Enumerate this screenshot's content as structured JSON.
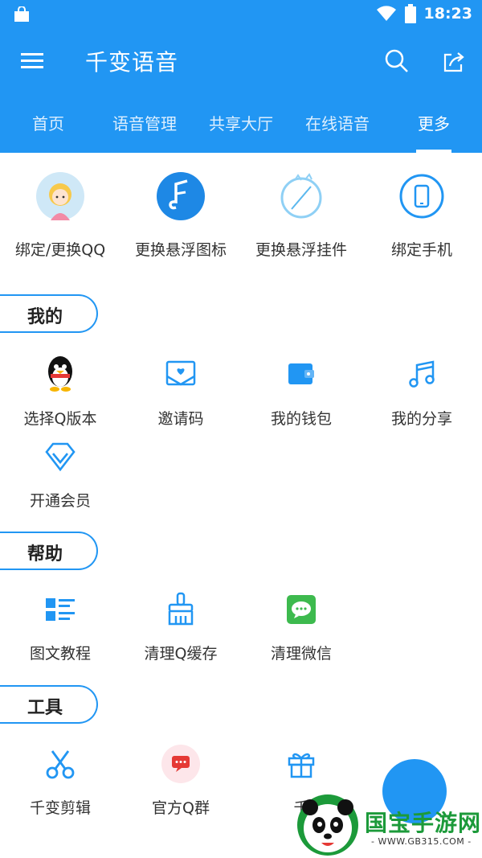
{
  "status_bar": {
    "time": "18:23"
  },
  "app": {
    "title": "千变语音"
  },
  "tabs": [
    {
      "label": "首页"
    },
    {
      "label": "语音管理"
    },
    {
      "label": "共享大厅"
    },
    {
      "label": "在线语音"
    },
    {
      "label": "更多"
    }
  ],
  "active_tab": "更多",
  "top_actions": [
    {
      "label": "绑定/更换QQ",
      "icon": "girl-avatar-icon"
    },
    {
      "label": "更换悬浮图标",
      "icon": "music-note-logo-icon"
    },
    {
      "label": "更换悬浮挂件",
      "icon": "floating-widget-icon"
    },
    {
      "label": "绑定手机",
      "icon": "phone-icon"
    }
  ],
  "sections": {
    "mine": {
      "title": "我的",
      "items": [
        {
          "label": "选择Q版本",
          "icon": "qq-penguin-icon"
        },
        {
          "label": "邀请码",
          "icon": "invite-envelope-icon"
        },
        {
          "label": "我的钱包",
          "icon": "wallet-icon"
        },
        {
          "label": "我的分享",
          "icon": "music-notes-icon"
        },
        {
          "label": "开通会员",
          "icon": "diamond-icon"
        }
      ]
    },
    "help": {
      "title": "帮助",
      "items": [
        {
          "label": "图文教程",
          "icon": "list-icon"
        },
        {
          "label": "清理Q缓存",
          "icon": "broom-icon"
        },
        {
          "label": "清理微信",
          "icon": "wechat-icon"
        }
      ]
    },
    "tools": {
      "title": "工具",
      "items": [
        {
          "label": "千变剪辑",
          "icon": "scissors-icon"
        },
        {
          "label": "官方Q群",
          "icon": "chat-bubble-icon"
        },
        {
          "label": "千",
          "icon": "gift-icon"
        }
      ]
    }
  },
  "watermark": {
    "text": "国宝手游网",
    "url": "- WWW.GB315.COM -"
  },
  "colors": {
    "primary": "#2196F3",
    "wechat": "#3DBA4E",
    "qq_red": "#E53935"
  }
}
